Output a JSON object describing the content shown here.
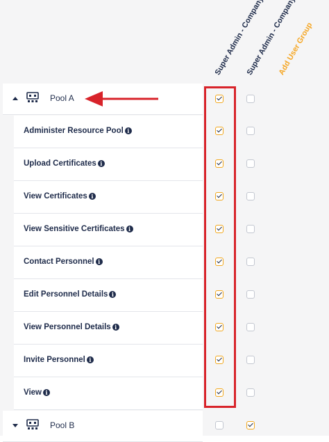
{
  "columns": [
    {
      "label": "Super Admin - Company A"
    },
    {
      "label": "Super Admin - Company B"
    },
    {
      "label": "Add User Group"
    }
  ],
  "pools": [
    {
      "name": "Pool A",
      "expanded": true,
      "col_a": true,
      "col_b": false
    },
    {
      "name": "Pool B",
      "expanded": false,
      "col_a": false,
      "col_b": true
    }
  ],
  "permissions": [
    {
      "label": "Administer Resource Pool",
      "col_a": true,
      "col_b": false
    },
    {
      "label": "Upload Certificates",
      "col_a": true,
      "col_b": false
    },
    {
      "label": "View Certificates",
      "col_a": true,
      "col_b": false
    },
    {
      "label": "View Sensitive Certificates",
      "col_a": true,
      "col_b": false
    },
    {
      "label": "Contact Personnel",
      "col_a": true,
      "col_b": false
    },
    {
      "label": "Edit Personnel Details",
      "col_a": true,
      "col_b": false
    },
    {
      "label": "View Personnel Details",
      "col_a": true,
      "col_b": false
    },
    {
      "label": "Invite Personnel",
      "col_a": true,
      "col_b": false
    },
    {
      "label": "View",
      "col_a": true,
      "col_b": false
    }
  ],
  "icons": {
    "info": "i"
  },
  "colors": {
    "checked": "#f2a81d",
    "highlight": "#d8232a",
    "accent": "#f5a623",
    "text": "#1e2b4a"
  }
}
